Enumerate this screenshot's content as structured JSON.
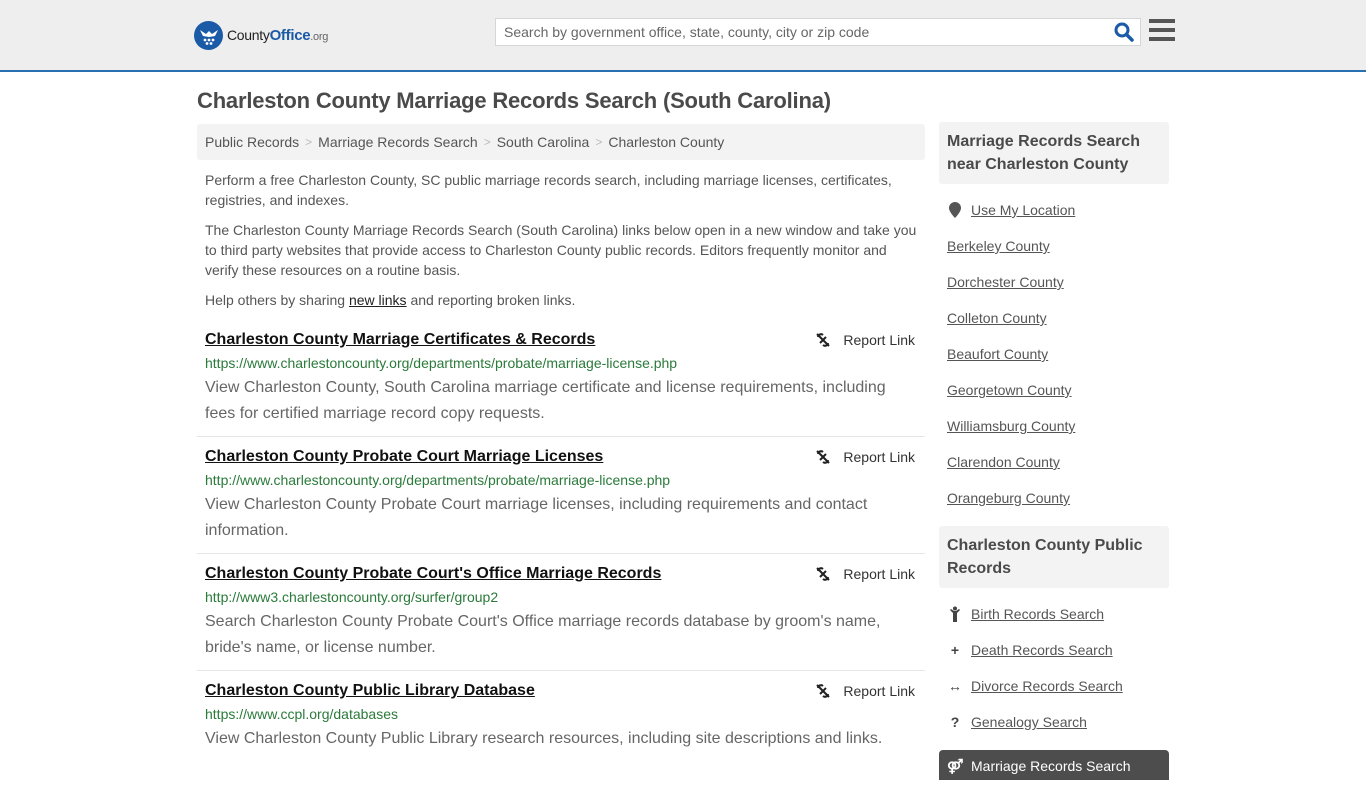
{
  "header": {
    "logo": {
      "brand": "County",
      "brand_accent": "Office",
      "tld": ".org"
    },
    "search": {
      "placeholder": "Search by government office, state, county, city or zip code",
      "value": ""
    },
    "icons": {
      "search": "search-icon",
      "menu": "hamburger-menu-icon"
    }
  },
  "page": {
    "title": "Charleston County Marriage Records Search (South Carolina)",
    "breadcrumb": [
      {
        "label": "Public Records"
      },
      {
        "label": "Marriage Records Search"
      },
      {
        "label": "South Carolina"
      },
      {
        "label": "Charleston County"
      }
    ],
    "breadcrumb_separator": ">",
    "intro": {
      "p1": "Perform a free Charleston County, SC public marriage records search, including marriage licenses, certificates, registries, and indexes.",
      "p2": "The Charleston County Marriage Records Search (South Carolina) links below open in a new window and take you to third party websites that provide access to Charleston County public records. Editors frequently monitor and verify these resources on a routine basis.",
      "p3_before": "Help others by sharing ",
      "p3_link": "new links",
      "p3_after": " and reporting broken links."
    }
  },
  "results": [
    {
      "title": "Charleston County Marriage Certificates & Records",
      "url": "https://www.charlestoncounty.org/departments/probate/marriage-license.php",
      "description": "View Charleston County, South Carolina marriage certificate and license requirements, including fees for certified marriage record copy requests.",
      "report_label": "Report Link"
    },
    {
      "title": "Charleston County Probate Court Marriage Licenses",
      "url": "http://www.charlestoncounty.org/departments/probate/marriage-license.php",
      "description": "View Charleston County Probate Court marriage licenses, including requirements and contact information.",
      "report_label": "Report Link"
    },
    {
      "title": "Charleston County Probate Court's Office Marriage Records",
      "url": "http://www3.charlestoncounty.org/surfer/group2",
      "description": "Search Charleston County Probate Court's Office marriage records database by groom's name, bride's name, or license number.",
      "report_label": "Report Link"
    },
    {
      "title": "Charleston County Public Library Database",
      "url": "https://www.ccpl.org/databases",
      "description": "View Charleston County Public Library research resources, including site descriptions and links.",
      "report_label": "Report Link"
    }
  ],
  "sidebar": {
    "nearby": {
      "heading": "Marriage Records Search near Charleston County",
      "use_location": "Use My Location",
      "counties": [
        "Berkeley County",
        "Dorchester County",
        "Colleton County",
        "Beaufort County",
        "Georgetown County",
        "Williamsburg County",
        "Clarendon County",
        "Orangeburg County"
      ]
    },
    "public_records": {
      "heading": "Charleston County Public Records",
      "items": [
        {
          "label": "Birth Records Search",
          "icon": "child-icon",
          "glyph": "Ὣ"
        },
        {
          "label": "Death Records Search",
          "icon": "plus-icon",
          "glyph": "+"
        },
        {
          "label": "Divorce Records Search",
          "icon": "arrows-horizontal-icon",
          "glyph": "↔"
        },
        {
          "label": "Genealogy Search",
          "icon": "question-icon",
          "glyph": "?"
        }
      ],
      "active_item": {
        "label": "Marriage Records Search",
        "icon": "gender-icon",
        "glyph": "⚤"
      }
    }
  },
  "colors": {
    "brand_blue": "#1a5aa6",
    "header_bg": "#eeeeee",
    "url_green": "#2a7a3a",
    "active_bg": "#4d4d4d"
  }
}
